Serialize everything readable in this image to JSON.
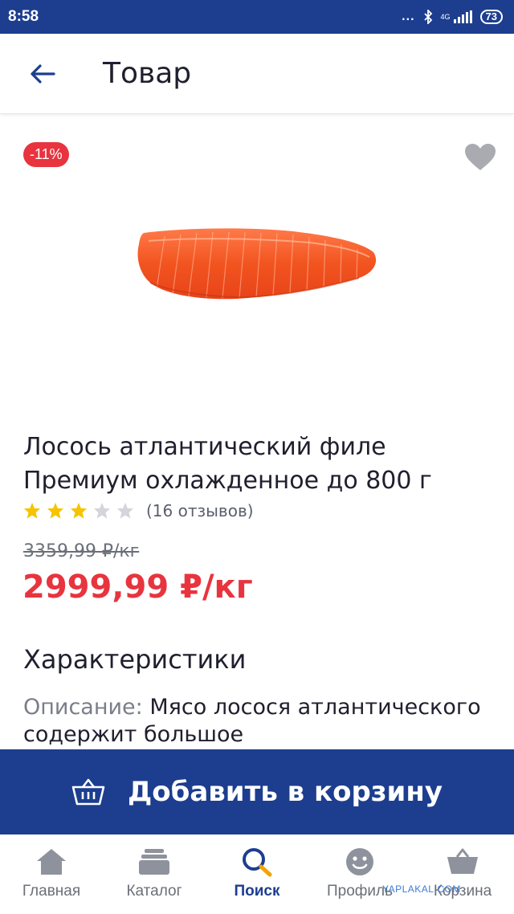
{
  "status_bar": {
    "time": "8:58",
    "dots": "...",
    "network": "4G",
    "battery": "73"
  },
  "header": {
    "title": "Товар"
  },
  "product": {
    "discount": "-11%",
    "name": "Лосось атлантический филе Премиум охлажденное до 800 г",
    "rating": 3,
    "rating_max": 5,
    "reviews": "(16 отзывов)",
    "old_price": "3359,99 ₽/кг",
    "price": "2999,99 ₽/кг"
  },
  "characteristics": {
    "title": "Характеристики",
    "description_label": "Описание:",
    "description_text": " Мясо лосося атлантического содержит большое"
  },
  "cart_button": {
    "label": "Добавить в корзину"
  },
  "bottom_nav": {
    "items": [
      {
        "label": "Главная"
      },
      {
        "label": "Каталог"
      },
      {
        "label": "Поиск"
      },
      {
        "label": "Профиль"
      },
      {
        "label": "Корзина"
      }
    ]
  },
  "watermark": "YAPLAKAL.COM",
  "colors": {
    "brand_blue": "#1d3e8f",
    "accent_red": "#e8343f",
    "star_yellow": "#f5c400",
    "star_gray": "#d3d5da"
  }
}
